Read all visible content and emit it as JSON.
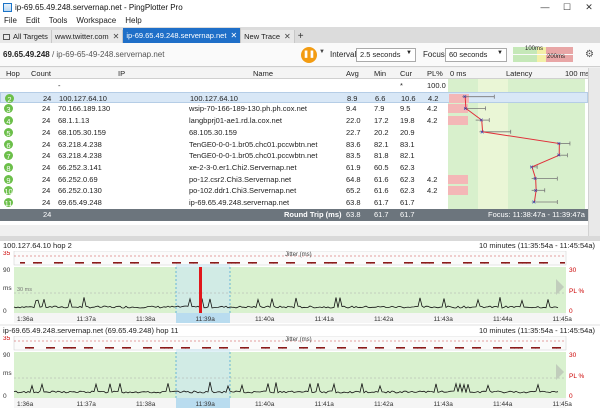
{
  "window": {
    "title": "ip-69.65.49.248.servernap.net - PingPlotter Pro",
    "icon": "pingplotter-icon"
  },
  "menu": [
    "File",
    "Edit",
    "Tools",
    "Workspace",
    "Help"
  ],
  "tabs": [
    {
      "label": "All Targets",
      "active": false
    },
    {
      "label": "www.twitter.com",
      "active": false
    },
    {
      "label": "ip-69.65.49.248.servernap.net",
      "active": true
    },
    {
      "label": "New Trace",
      "active": false
    }
  ],
  "toolbar": {
    "target_ip": "69.65.49.248",
    "target_host": "/ ip-69-65-49-248.servernap.net",
    "interval_label": "Interval",
    "interval_value": "2.5 seconds",
    "focus_label": "Focus",
    "focus_value": "60 seconds",
    "scale_top": "100ms",
    "scale_bottom": "200ms",
    "accent": "#f39c12"
  },
  "table": {
    "headers": {
      "hop": "Hop",
      "count": "Count",
      "ip": "IP",
      "name": "Name",
      "avg": "Avg",
      "min": "Min",
      "cur": "Cur",
      "pl": "PL%",
      "ms0": "0 ms",
      "latency": "Latency",
      "ms100": "100 ms"
    },
    "rows": [
      {
        "hop": "",
        "count": "",
        "ip": "-",
        "name": "",
        "avg": "",
        "min": "",
        "cur": "*",
        "pl": "100.0",
        "lat": null,
        "min_lat": null,
        "max_lat": null
      },
      {
        "hop": "2",
        "count": "24",
        "ip": "100.127.64.10",
        "name": "100.127.64.10",
        "avg": "8.9",
        "min": "6.6",
        "cur": "10.6",
        "pl": "4.2",
        "lat": 8.9,
        "min_lat": 6.6,
        "max_lat": 32
      },
      {
        "hop": "3",
        "count": "24",
        "ip": "70.166.189.130",
        "name": "wsip-70-166-189-130.ph.ph.cox.net",
        "avg": "9.4",
        "min": "7.9",
        "cur": "9.5",
        "pl": "4.2",
        "lat": 9.4,
        "min_lat": 7.9,
        "max_lat": 25
      },
      {
        "hop": "4",
        "count": "24",
        "ip": "68.1.1.13",
        "name": "langbprj01-ae1.rd.la.cox.net",
        "avg": "22.0",
        "min": "17.2",
        "cur": "19.8",
        "pl": "4.2",
        "lat": 22.0,
        "min_lat": 17.2,
        "max_lat": 28
      },
      {
        "hop": "5",
        "count": "24",
        "ip": "68.105.30.159",
        "name": "68.105.30.159",
        "avg": "22.7",
        "min": "20.2",
        "cur": "20.9",
        "pl": "",
        "lat": 22.7,
        "min_lat": 20.2,
        "max_lat": 45
      },
      {
        "hop": "6",
        "count": "24",
        "ip": "63.218.4.238",
        "name": "TenGE0-0-0-1.br05.chc01.pccwbtn.net",
        "avg": "83.6",
        "min": "82.1",
        "cur": "83.1",
        "pl": "",
        "lat": 83.6,
        "min_lat": 82.1,
        "max_lat": 92
      },
      {
        "hop": "7",
        "count": "24",
        "ip": "63.218.4.238",
        "name": "TenGE0-0-0-1.br05.chc01.pccwbtn.net",
        "avg": "83.5",
        "min": "81.8",
        "cur": "82.1",
        "pl": "",
        "lat": 83.5,
        "min_lat": 81.8,
        "max_lat": 90
      },
      {
        "hop": "8",
        "count": "24",
        "ip": "66.252.3.141",
        "name": "xe-2-3-0.er1.Chi2.Servernap.net",
        "avg": "61.9",
        "min": "60.5",
        "cur": "62.3",
        "pl": "",
        "lat": 61.9,
        "min_lat": 60.5,
        "max_lat": 66
      },
      {
        "hop": "9",
        "count": "24",
        "ip": "66.252.0.69",
        "name": "po-12.csr2.Chi3.Servernap.net",
        "avg": "64.8",
        "min": "61.6",
        "cur": "62.3",
        "pl": "4.2",
        "lat": 64.8,
        "min_lat": 61.6,
        "max_lat": 82
      },
      {
        "hop": "10",
        "count": "24",
        "ip": "66.252.0.130",
        "name": "po-102.ddr1.Chi3.Servernap.net",
        "avg": "65.2",
        "min": "61.6",
        "cur": "62.3",
        "pl": "4.2",
        "lat": 65.2,
        "min_lat": 61.6,
        "max_lat": 72
      },
      {
        "hop": "11",
        "count": "24",
        "ip": "69.65.49.248",
        "name": "ip-69.65.49.248.servernap.net",
        "avg": "63.8",
        "min": "61.7",
        "cur": "61.7",
        "pl": "",
        "lat": 63.8,
        "min_lat": 61.7,
        "max_lat": 82
      }
    ],
    "footer": {
      "count": "24",
      "label": "Round Trip (ms)",
      "avg": "63.8",
      "min": "61.7",
      "cur": "61.7",
      "focus": "Focus: 11:38:47a - 11:39:47a"
    }
  },
  "graphs": [
    {
      "title": "100.127.64.10 hop 2",
      "range": "10 minutes (11:35:54a - 11:45:54a)",
      "jitter": "Jitter (ms)",
      "y_top": "35",
      "y_max": "90",
      "y_unit": "ms",
      "y_mid": "30 ms",
      "y_min": "0",
      "pl_top": "30",
      "pl_unit": "PL %",
      "pl_min": "0",
      "times": [
        "1:36a",
        "11:37a",
        "11:38a",
        "11:39a",
        "11:40a",
        "11:41a",
        "11:42a",
        "11:43a",
        "11:44a",
        "11:45a"
      ],
      "spike": true
    },
    {
      "title": "ip-69.65.49.248.servernap.net (69.65.49.248) hop 11",
      "range": "10 minutes (11:35:54a - 11:45:54a)",
      "jitter": "Jitter (ms)",
      "y_top": "35",
      "y_max": "90",
      "y_unit": "ms",
      "y_mid": "",
      "y_min": "0",
      "pl_top": "30",
      "pl_unit": "PL %",
      "pl_min": "0",
      "times": [
        "1:36a",
        "11:37a",
        "11:38a",
        "11:39a",
        "11:40a",
        "11:41a",
        "11:42a",
        "11:43a",
        "11:44a",
        "11:45a"
      ],
      "spike": false
    }
  ]
}
